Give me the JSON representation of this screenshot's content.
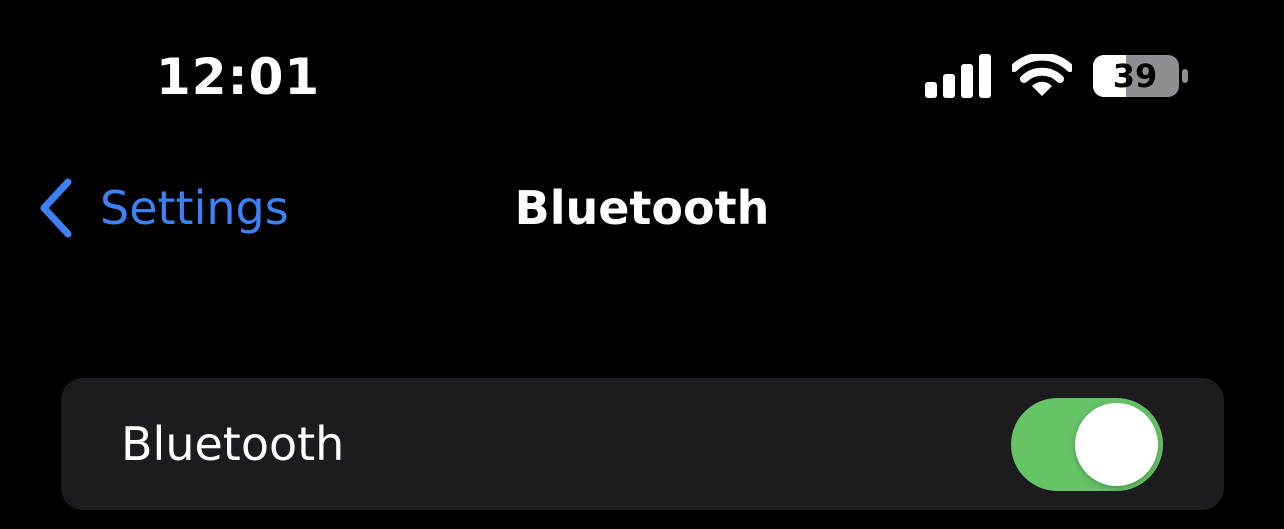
{
  "status_bar": {
    "time": "12:01",
    "battery_level": "39",
    "icons": [
      "signal-icon",
      "wifi-icon",
      "battery-icon"
    ]
  },
  "nav": {
    "back_label": "Settings",
    "title": "Bluetooth"
  },
  "bluetooth_group": {
    "row_label": "Bluetooth",
    "toggle_on": true
  },
  "colors": {
    "background": "#000000",
    "group_background": "#1c1c1e",
    "accent_blue": "#3c82f6",
    "toggle_green": "#65c466",
    "text": "#ffffff"
  }
}
